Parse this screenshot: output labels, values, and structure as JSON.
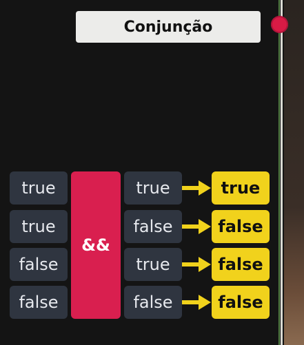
{
  "title": "Conjunção",
  "operator": "&&",
  "rows": [
    {
      "a": "true",
      "b": "true",
      "result": "true"
    },
    {
      "a": "true",
      "b": "false",
      "result": "false"
    },
    {
      "a": "false",
      "b": "true",
      "result": "false"
    },
    {
      "a": "false",
      "b": "false",
      "result": "false"
    }
  ],
  "colors": {
    "background": "#141414",
    "input_cell": "#2f3540",
    "operator": "#d91f4f",
    "result_cell": "#f1d21c",
    "arrow": "#f1d21c",
    "dot": "#d81b45"
  }
}
